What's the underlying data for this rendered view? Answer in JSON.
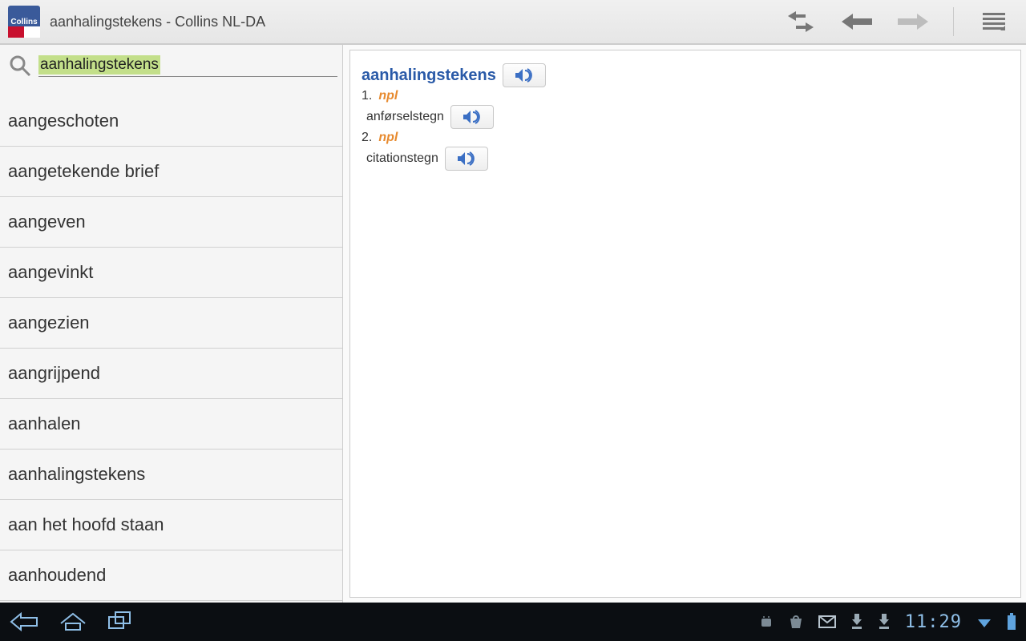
{
  "toolbar": {
    "app_icon_text": "Collins",
    "title": "aanhalingstekens - Collins NL-DA"
  },
  "search": {
    "query": "aanhalingstekens"
  },
  "word_list": [
    "aangeschoten",
    "aangetekende brief",
    "aangeven",
    "aangevinkt",
    "aangezien",
    "aangrijpend",
    "aanhalen",
    "aanhalingstekens",
    "aan het hoofd staan",
    "aanhoudend"
  ],
  "entry": {
    "headword": "aanhalingstekens",
    "senses": [
      {
        "num": "1.",
        "grammar": "npl",
        "translation": "anførselstegn"
      },
      {
        "num": "2.",
        "grammar": "npl",
        "translation": "citationstegn"
      }
    ]
  },
  "sysbar": {
    "time": "11:29"
  }
}
